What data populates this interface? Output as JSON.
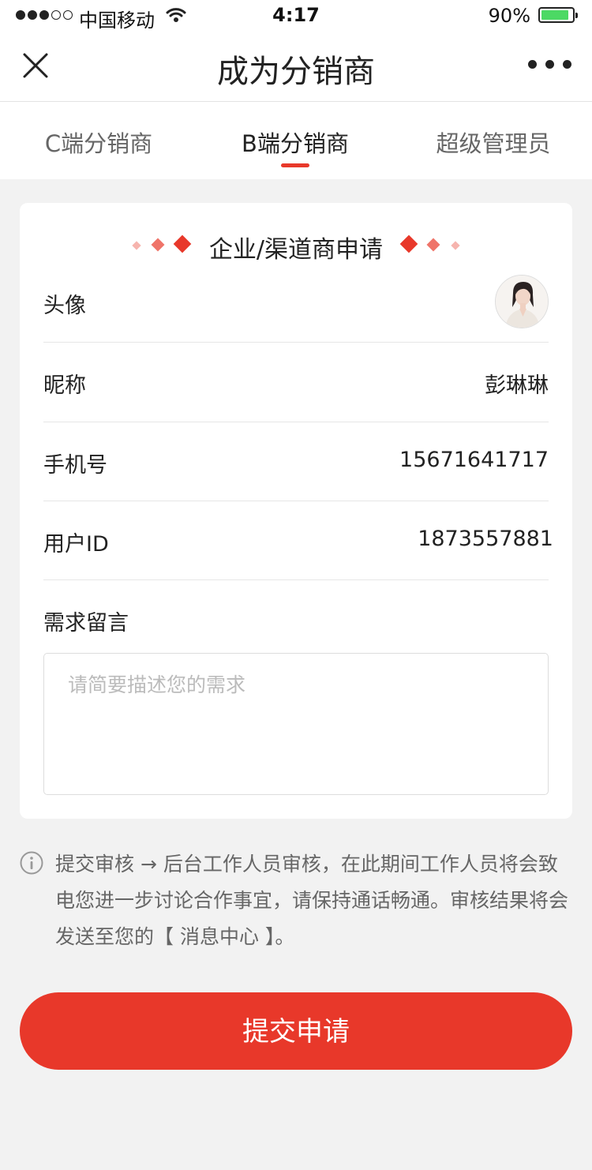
{
  "status_bar": {
    "carrier": "中国移动",
    "time": "4:17",
    "battery_percent": "90%",
    "battery_level": 0.9,
    "signal_bars": 3
  },
  "navbar": {
    "title": "成为分销商",
    "close_icon": "close-icon",
    "more_icon": "more-dots-icon"
  },
  "tabs": [
    {
      "label": "C端分销商",
      "active": false
    },
    {
      "label": "B端分销商",
      "active": true
    },
    {
      "label": "超级管理员",
      "active": false
    }
  ],
  "form": {
    "title": "企业/渠道商申请",
    "avatar_label": "头像",
    "nickname_label": "昵称",
    "nickname_value": "彭琳琳",
    "phone_label": "手机号",
    "phone_value": "15671641717",
    "userid_label": "用户ID",
    "userid_value": "1873557881",
    "message_label": "需求留言",
    "message_placeholder": "请简要描述您的需求"
  },
  "notice": {
    "text": "提交审核 → 后台工作人员审核，在此期间工作人员将会致电您进一步讨论合作事宜，请保持通话畅通。审核结果将会发送至您的【 消息中心 】。"
  },
  "submit_label": "提交申请",
  "colors": {
    "accent": "#e8382a",
    "background": "#f2f2f2",
    "battery": "#4cd964"
  }
}
